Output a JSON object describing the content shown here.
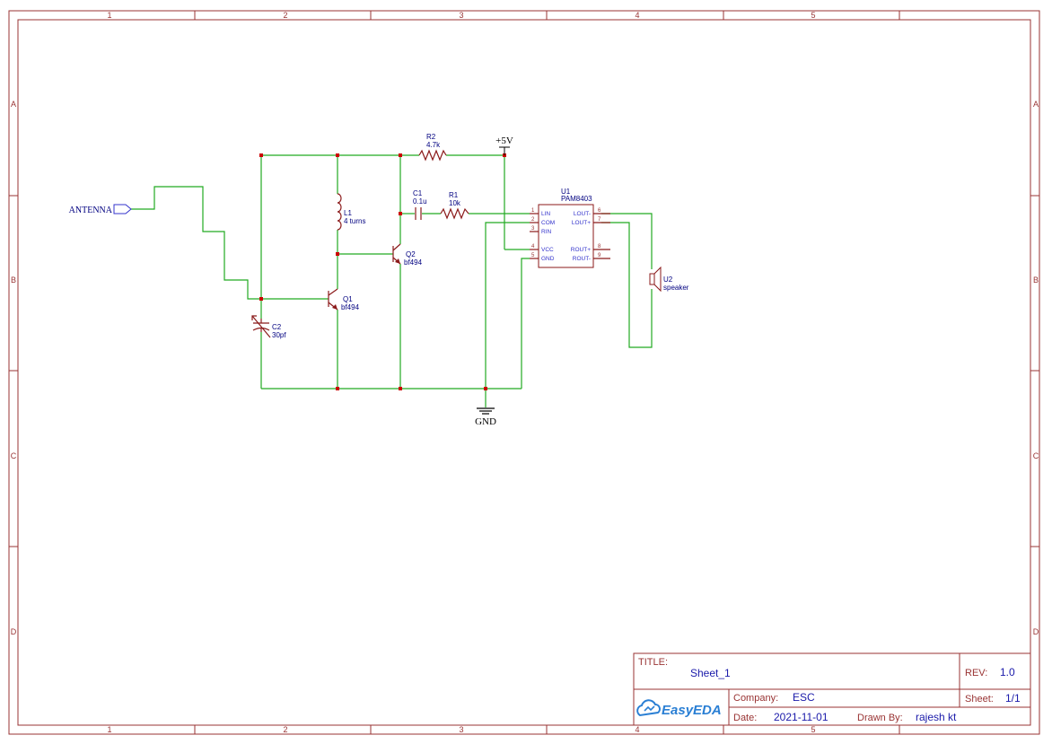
{
  "zones": {
    "columns": [
      "1",
      "2",
      "3",
      "4",
      "5"
    ],
    "rows": [
      "A",
      "B",
      "C",
      "D"
    ]
  },
  "components": {
    "r2": {
      "ref": "R2",
      "value": "4.7k"
    },
    "c1": {
      "ref": "C1",
      "value": "0.1u"
    },
    "r1": {
      "ref": "R1",
      "value": "10k"
    },
    "l1": {
      "ref": "L1",
      "value": "4 turns"
    },
    "q1": {
      "ref": "Q1",
      "value": "bf494"
    },
    "q2": {
      "ref": "Q2",
      "value": "bf494"
    },
    "c2": {
      "ref": "C2",
      "value": "30pf"
    },
    "u1": {
      "ref": "U1",
      "value": "PAM8403",
      "left_pins": [
        {
          "num": "1",
          "name": "LIN"
        },
        {
          "num": "2",
          "name": "COM"
        },
        {
          "num": "3",
          "name": "RIN"
        },
        {
          "num": "4",
          "name": "VCC"
        },
        {
          "num": "5",
          "name": "GND"
        }
      ],
      "right_pins": [
        {
          "num": "6",
          "name": "LOUT-"
        },
        {
          "num": "7",
          "name": "LOUT+"
        },
        {
          "num": "8",
          "name": "ROUT+"
        },
        {
          "num": "9",
          "name": "ROUT-"
        }
      ]
    },
    "u2": {
      "ref": "U2",
      "value": "speaker"
    }
  },
  "nets": {
    "antenna": "ANTENNA",
    "vcc": "+5V",
    "gnd": "GND"
  },
  "title_block": {
    "title_label": "TITLE:",
    "title": "Sheet_1",
    "rev_label": "REV:",
    "rev": "1.0",
    "company_label": "Company:",
    "company": "ESC",
    "sheet_label": "Sheet:",
    "sheet": "1/1",
    "date_label": "Date:",
    "date": "2021-11-01",
    "drawn_by_label": "Drawn By:",
    "drawn_by": "rajesh kt",
    "brand": "EasyEDA"
  },
  "colors": {
    "frame": "#993333",
    "wire": "#22aa22",
    "component": "#8b1a1a",
    "junction": "#cc0000",
    "text": "#000080"
  }
}
